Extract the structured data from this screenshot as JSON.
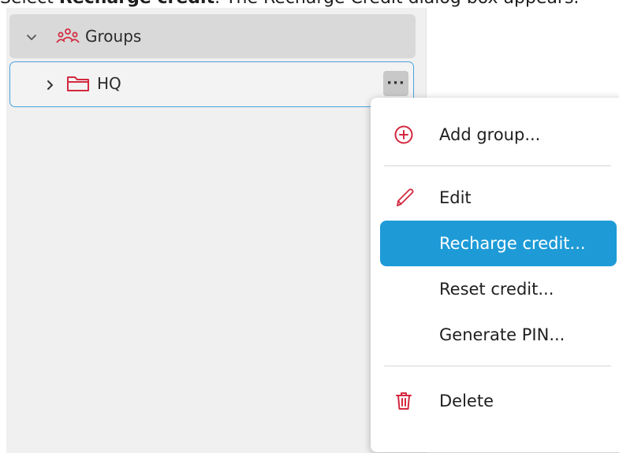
{
  "caption": {
    "prefix": "Select ",
    "bold": "Recharge credit",
    "suffix": ". The Recharge Credit dialog box appears."
  },
  "tree": {
    "groups_label": "Groups",
    "hq_label": "HQ",
    "more_button_label": "···"
  },
  "menu": {
    "add_group": "Add group...",
    "edit": "Edit",
    "recharge_credit": "Recharge credit...",
    "reset_credit": "Reset credit...",
    "generate_pin": "Generate PIN...",
    "delete": "Delete"
  },
  "colors": {
    "accent": "#1e9bd7",
    "icon_red": "#d3293f",
    "selection_border": "#4aa3df"
  },
  "icons": {
    "groups": "users-group-icon",
    "folder": "folder-icon",
    "add": "plus-circle-icon",
    "edit": "pencil-icon",
    "delete": "trash-icon"
  }
}
